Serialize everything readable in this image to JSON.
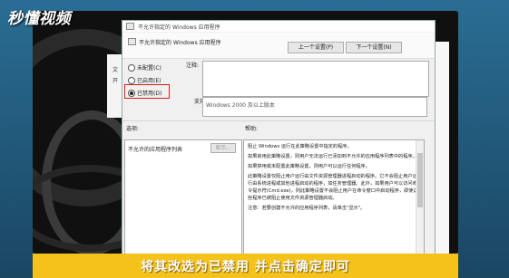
{
  "watermark": {
    "text": "秒懂视频"
  },
  "window": {
    "title": "不允许指定的 Windows 应用程序"
  },
  "header": {
    "policy_title": "不允许指定的 Windows 应用程序",
    "prev_setting": "上一个设置(P)",
    "next_setting": "下一个设置(N)"
  },
  "radios": [
    {
      "label": "未配置(C)",
      "checked": false
    },
    {
      "label": "已启用(E)",
      "checked": false
    },
    {
      "label": "已禁用(D)",
      "checked": true
    }
  ],
  "comment_label": "注释:",
  "supported_label": "支持的平台:",
  "supported_value": "Windows 2000 及以上版本",
  "options_label": "选项:",
  "help_label": "帮助:",
  "options_item": "不允许的应用程序列表",
  "options_button": "显示...",
  "help_text": [
    "阻止 Windows 运行在此策略设置中指定的程序。",
    "如果启用此策略设置，则用户无法运行已添加到不允许的应用程序列表中的程序。",
    "如果禁用或未配置此策略设置，则用户可以运行任何程序。",
    "此策略设置仅阻止用户运行由文件资源管理器进程启动的程序。它不会阻止用户运行由系统进程或其他进程启动的程序，如任务管理器。此外，如果用户可以访问命令提示符(Cmd.exe)，则此策略设置不会阻止用户在命令窗口中启动程序，即使这些程序已被阻止使用文件资源管理器启动。",
    "注意：若要创建不允许的应用程序列表，请单击\"显示\"。"
  ],
  "peek_text": [
    "文",
    "开"
  ],
  "caption": "将其改选为已禁用 并点击确定即可",
  "colors": {
    "caption_bg": "#f5c21b",
    "highlight": "#d91e1e"
  }
}
